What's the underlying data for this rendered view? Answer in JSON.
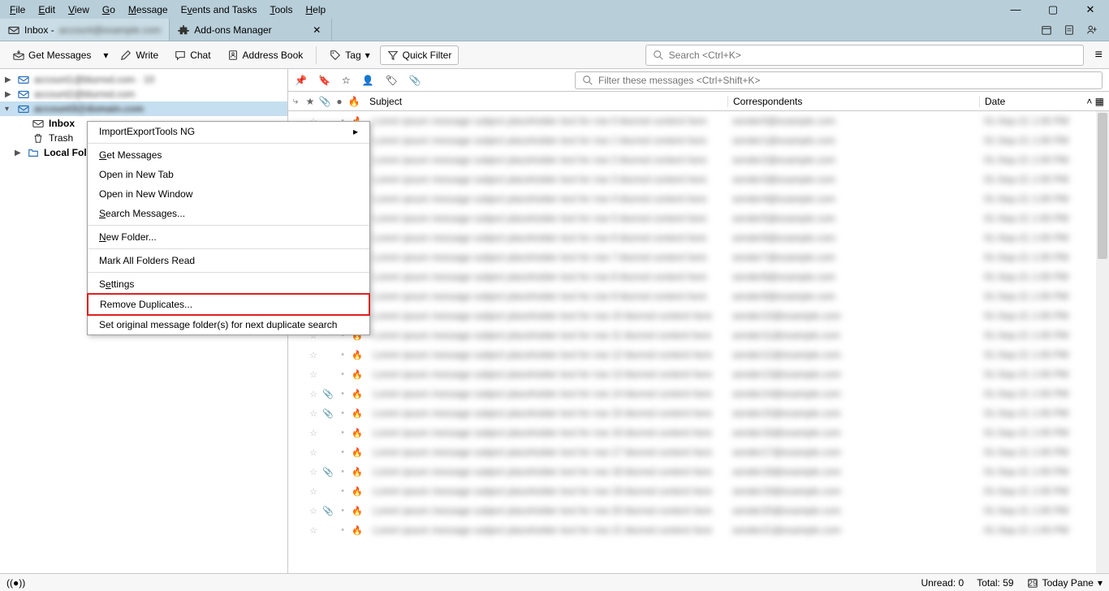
{
  "menubar": [
    "File",
    "Edit",
    "View",
    "Go",
    "Message",
    "Events and Tasks",
    "Tools",
    "Help"
  ],
  "tabs": {
    "inbox_prefix": "Inbox - ",
    "addons": "Add-ons Manager"
  },
  "toolbar": {
    "get_messages": "Get Messages",
    "write": "Write",
    "chat": "Chat",
    "address_book": "Address Book",
    "tag": "Tag",
    "quick_filter": "Quick Filter",
    "search_placeholder": "Search <Ctrl+K>"
  },
  "folders": {
    "inbox": "Inbox",
    "trash": "Trash",
    "local": "Local Folders"
  },
  "msg_toolbar": {
    "filter_placeholder": "Filter these messages <Ctrl+Shift+K>"
  },
  "columns": {
    "subject": "Subject",
    "correspondents": "Correspondents",
    "date": "Date"
  },
  "context_menu": {
    "import_export": "ImportExportTools NG",
    "get_messages": "Get Messages",
    "open_tab": "Open in New Tab",
    "open_window": "Open in New Window",
    "search": "Search Messages...",
    "new_folder": "New Folder...",
    "mark_read": "Mark All Folders Read",
    "settings": "Settings",
    "remove_dup": "Remove Duplicates...",
    "set_original": "Set original message folder(s) for next duplicate search"
  },
  "status": {
    "unread_label": "Unread:",
    "unread_value": "0",
    "total_label": "Total:",
    "total_value": "59",
    "today_pane": "Today Pane"
  }
}
